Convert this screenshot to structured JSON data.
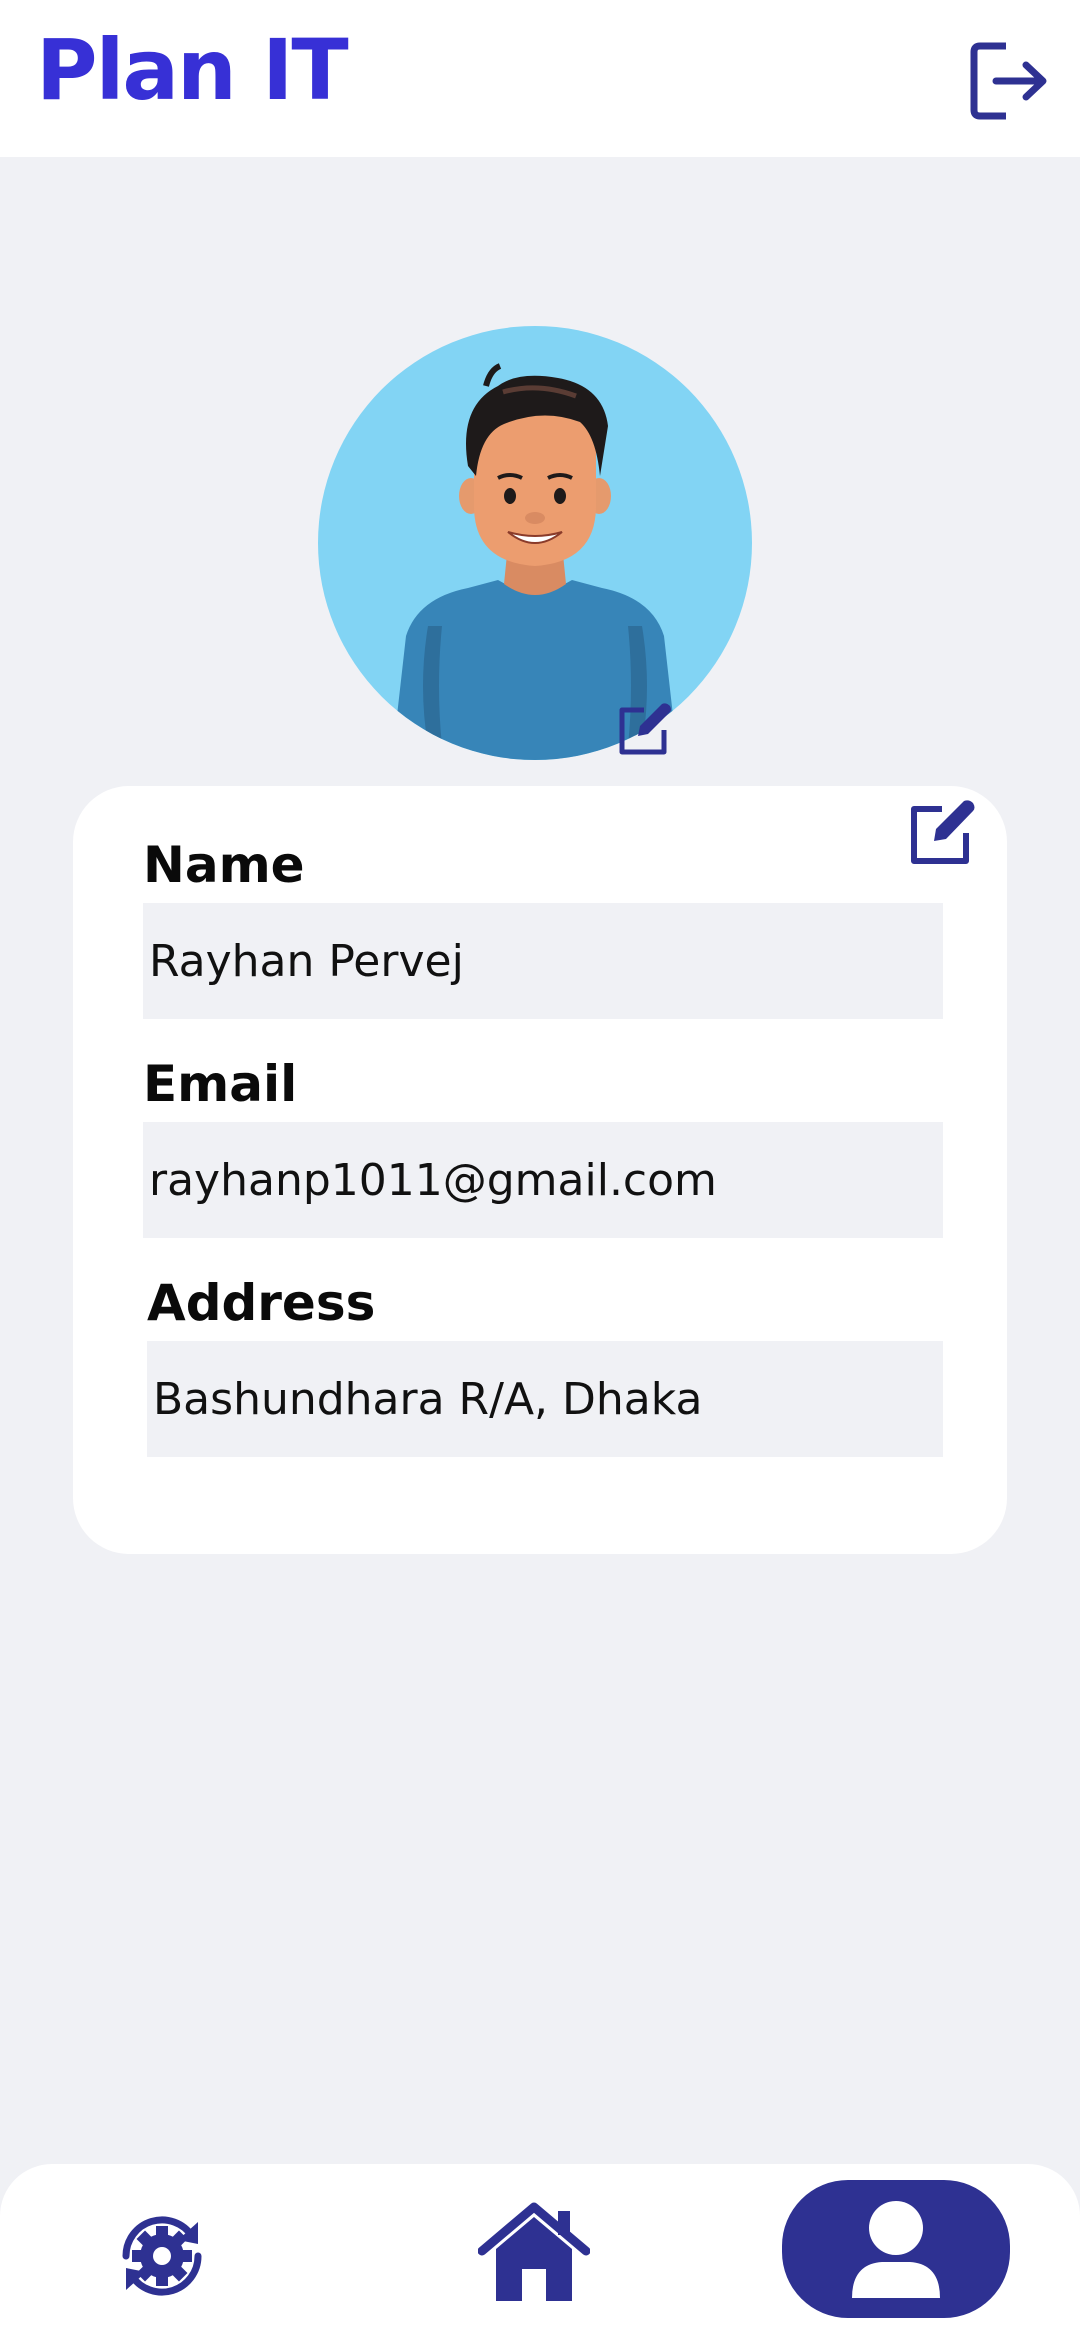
{
  "header": {
    "title": "Plan IT",
    "logout_icon": "logout-icon"
  },
  "profile": {
    "avatar": "avatar-illustration",
    "avatar_edit_icon": "edit-icon",
    "card_edit_icon": "edit-icon",
    "fields": [
      {
        "label": "Name",
        "value": "Rayhan Pervej"
      },
      {
        "label": "Email",
        "value": "rayhanp1011@gmail.com"
      },
      {
        "label": "Address",
        "value": "Bashundhara R/A, Dhaka"
      }
    ]
  },
  "nav": {
    "items": [
      {
        "icon": "settings-sync-icon",
        "active": false
      },
      {
        "icon": "home-icon",
        "active": false
      },
      {
        "icon": "user-icon",
        "active": true
      }
    ]
  },
  "colors": {
    "brand": "#3730d6",
    "accent": "#2e3192",
    "background": "#f0f1f5",
    "avatar_bg": "#82d4f4"
  }
}
